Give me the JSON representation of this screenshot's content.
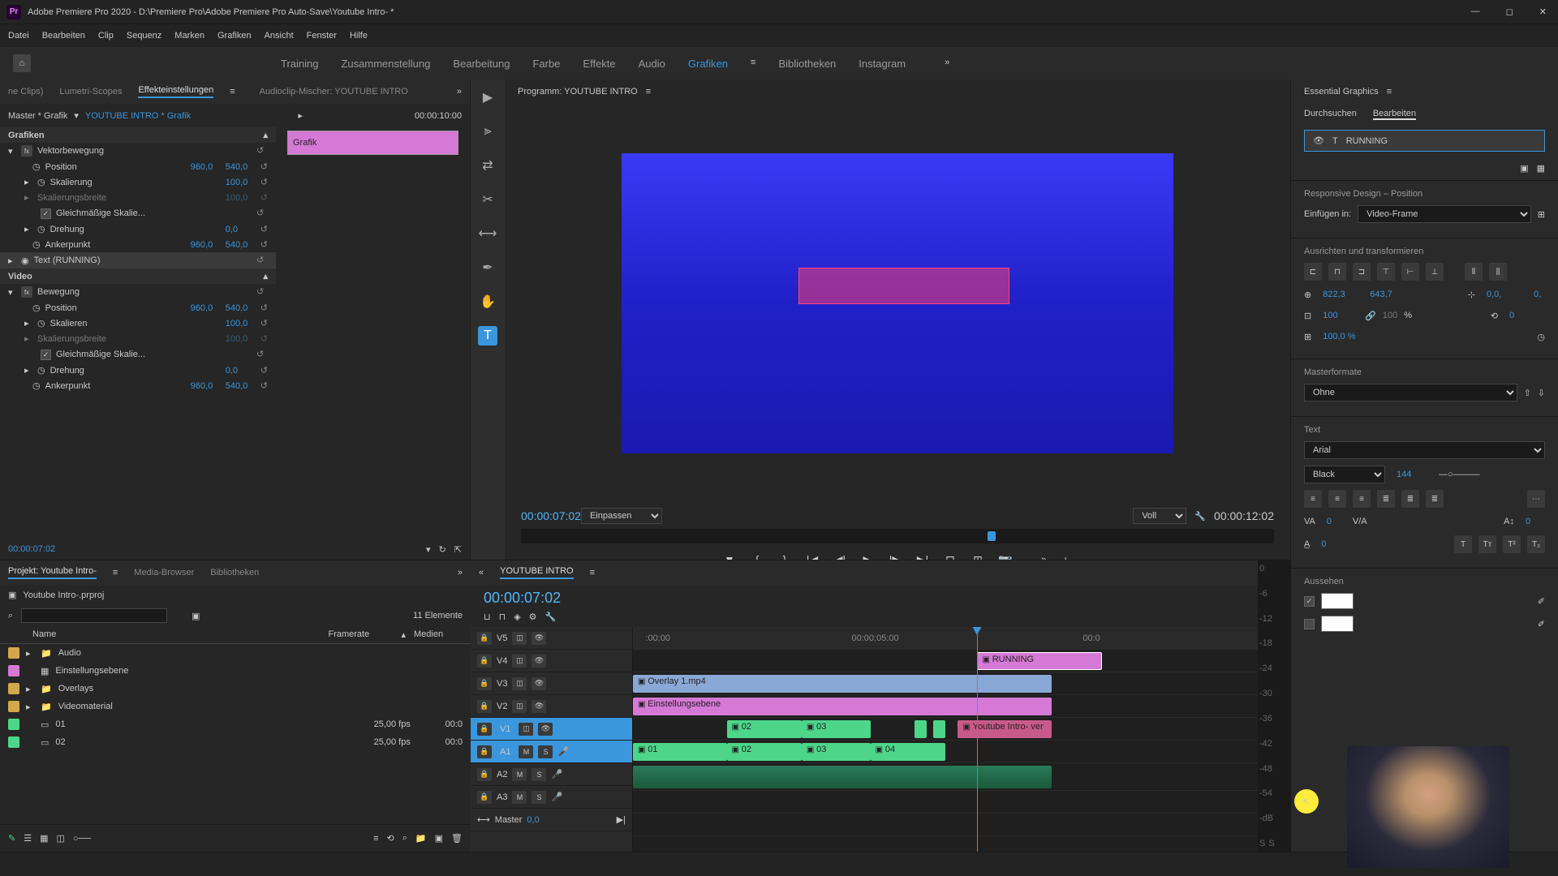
{
  "title_bar": {
    "app_name": "Adobe Premiere Pro 2020",
    "file_path": "D:\\Premiere Pro\\Adobe Premiere Pro Auto-Save\\Youtube Intro- *"
  },
  "menu": [
    "Datei",
    "Bearbeiten",
    "Clip",
    "Sequenz",
    "Marken",
    "Grafiken",
    "Ansicht",
    "Fenster",
    "Hilfe"
  ],
  "workspaces": [
    "Training",
    "Zusammenstellung",
    "Bearbeitung",
    "Farbe",
    "Effekte",
    "Audio",
    "Grafiken",
    "Bibliotheken",
    "Instagram"
  ],
  "workspace_active": "Grafiken",
  "effect_tabs": [
    "ne Clips)",
    "Lumetri-Scopes",
    "Effekteinstellungen",
    "Audioclip-Mischer: YOUTUBE INTRO"
  ],
  "effect_tab_active": "Effekteinstellungen",
  "effect_master": "Master * Grafik",
  "effect_sequence": "YOUTUBE INTRO * Grafik",
  "effect_timecode_header": "00:00:10:00",
  "effect_timeline_label": "Grafik",
  "effects": {
    "section1": "Grafiken",
    "vektorbewegung": "Vektorbewegung",
    "position": "Position",
    "pos_x": "960,0",
    "pos_y": "540,0",
    "skalierung": "Skalierung",
    "skal_val": "100,0",
    "skalierungsbreite": "Skalierungsbreite",
    "skalb_val": "100,0",
    "gleichmassige": "Gleichmäßige Skalie...",
    "drehung": "Drehung",
    "dreh_val": "0,0",
    "ankerpunkt": "Ankerpunkt",
    "anker_x": "960,0",
    "anker_y": "540,0",
    "text_running": "Text (RUNNING)",
    "section2": "Video",
    "bewegung": "Bewegung",
    "skalieren": "Skalieren"
  },
  "effect_footer_tc": "00:00:07:02",
  "project_tabs": [
    "Projekt: Youtube Intro-",
    "Media-Browser",
    "Bibliotheken"
  ],
  "project_file": "Youtube Intro-.prproj",
  "project_count": "11 Elemente",
  "project_cols": {
    "name": "Name",
    "framerate": "Framerate",
    "medien": "Medien"
  },
  "project_items": [
    {
      "name": "Audio",
      "type": "folder",
      "color": "#d4a84a"
    },
    {
      "name": "Einstellungsebene",
      "type": "item",
      "color": "#d679d6"
    },
    {
      "name": "Overlays",
      "type": "folder",
      "color": "#d4a84a"
    },
    {
      "name": "Videomaterial",
      "type": "folder",
      "color": "#d4a84a"
    },
    {
      "name": "01",
      "fps": "25,00 fps",
      "dur": "00:0",
      "color": "#4dd68a"
    },
    {
      "name": "02",
      "fps": "25,00 fps",
      "dur": "00:0",
      "color": "#4dd68a"
    }
  ],
  "program": {
    "title": "Programm: YOUTUBE INTRO",
    "current_tc": "00:00:07:02",
    "fit": "Einpassen",
    "quality": "Voll",
    "duration": "00:00:12:02"
  },
  "timeline": {
    "title": "YOUTUBE INTRO",
    "timecode": "00:00:07:02",
    "ruler": [
      ":00:00",
      "00:00:05:00",
      "00:0"
    ],
    "tracks_v": [
      "V5",
      "V4",
      "V3",
      "V2",
      "V1"
    ],
    "tracks_a": [
      "A1",
      "A2",
      "A3"
    ],
    "master": "Master",
    "master_val": "0,0",
    "clips": {
      "v5": "RUNNING",
      "v4": "Overlay 1.mp4",
      "v3": "Einstellungsebene",
      "v2": [
        "02",
        "03",
        "Youtube Intro- ver"
      ],
      "v1": [
        "01",
        "02",
        "03",
        "04"
      ]
    }
  },
  "audio_levels": [
    "0",
    "-6",
    "-12",
    "-18",
    "-24",
    "-30",
    "-36",
    "-42",
    "-48",
    "-54",
    "-dB"
  ],
  "eg": {
    "title": "Essential Graphics",
    "tabs": [
      "Durchsuchen",
      "Bearbeiten"
    ],
    "tab_active": "Bearbeiten",
    "layer": "RUNNING",
    "responsive": "Responsive Design – Position",
    "einfugen": "Einfügen in:",
    "video_frame": "Video-Frame",
    "ausrichten": "Ausrichten und transformieren",
    "pos_x": "822,3",
    "pos_y": "643,7",
    "anchor": "0,0,",
    "anchor2": "0,",
    "scale": "100",
    "scale2": "100",
    "pct": "%",
    "rot": "0",
    "opacity": "100,0 %",
    "masterformate": "Masterformate",
    "ohne": "Ohne",
    "text_label": "Text",
    "font": "Arial",
    "weight": "Black",
    "size": "144",
    "track1": "0",
    "track2": "0",
    "track3": "0",
    "aussehen": "Aussehen"
  }
}
